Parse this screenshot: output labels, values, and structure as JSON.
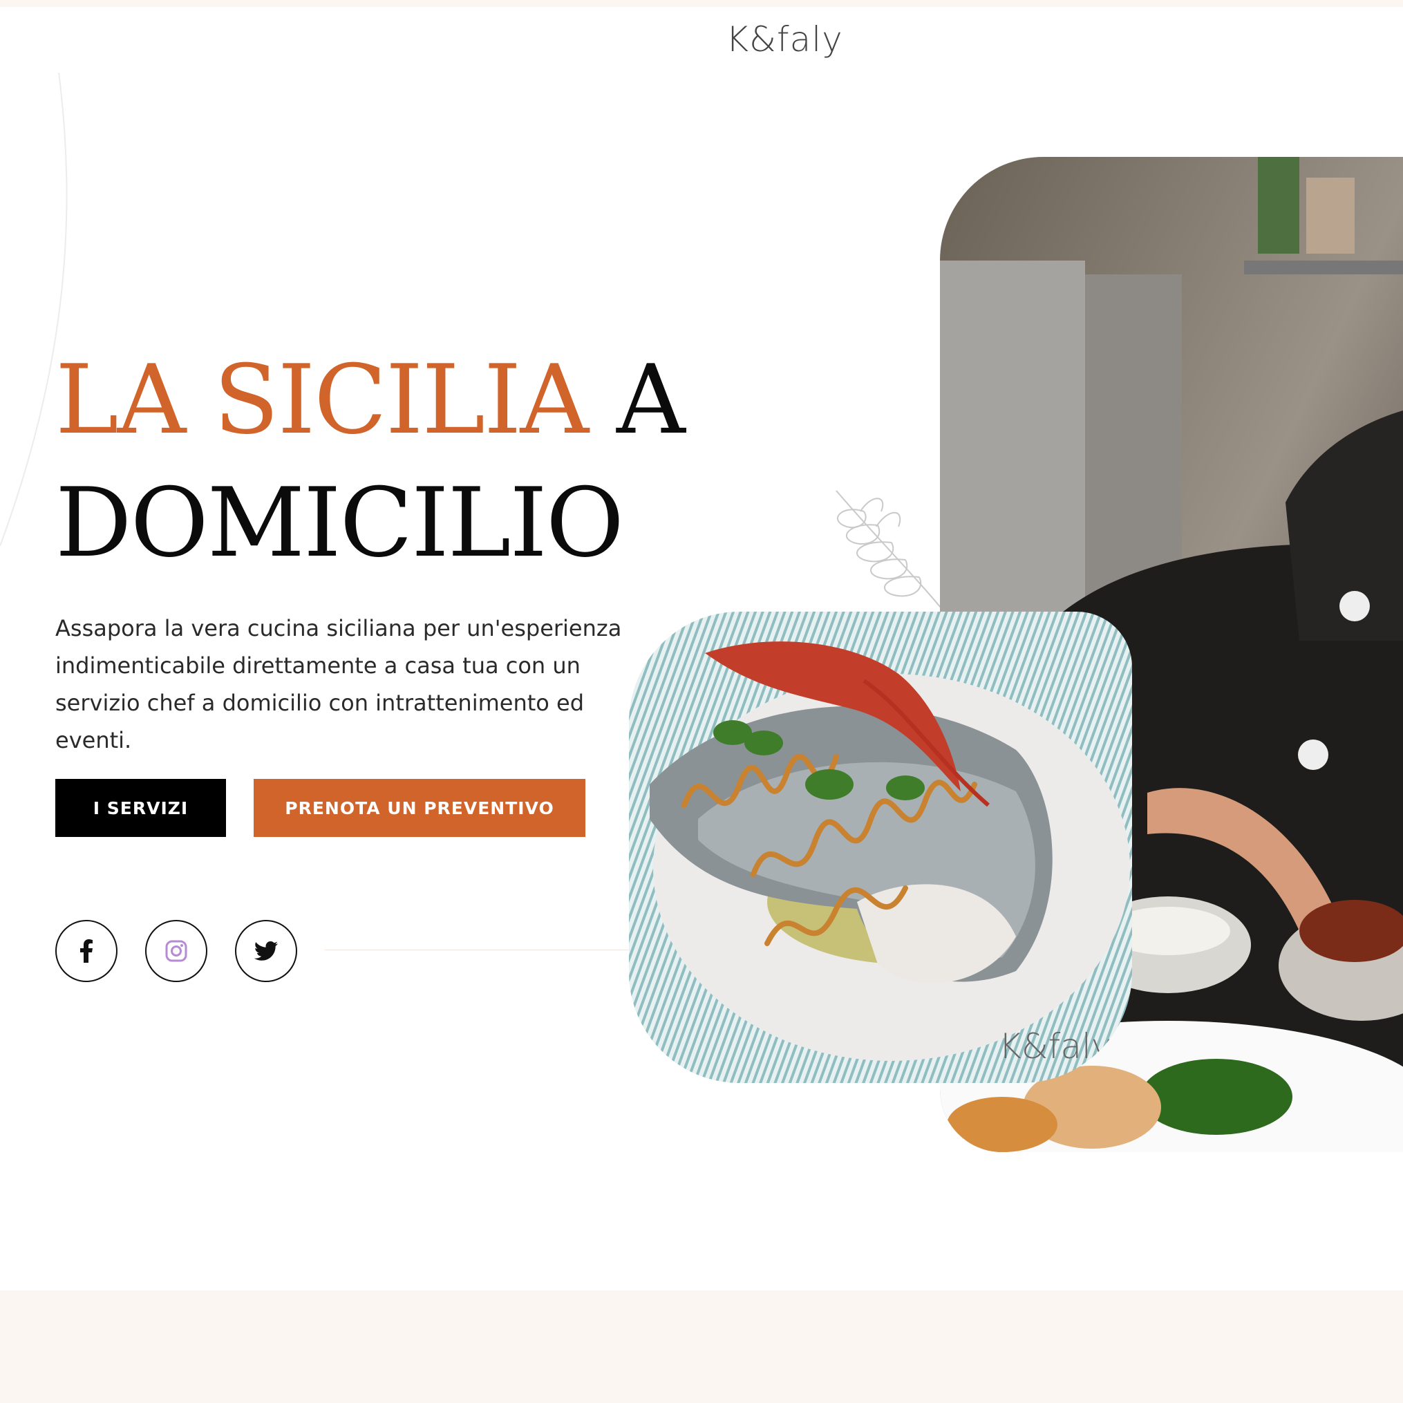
{
  "header": {
    "logo_text": "K&faly"
  },
  "hero": {
    "title_accent": "LA SICILIA",
    "title_rest": " A",
    "title_line2": "DOMICILIO",
    "description": "Assapora la vera cucina siciliana per un'esperienza indimenticabile direttamente a casa tua con un servizio chef a domicilio con intrattenimento ed eventi.",
    "buttons": {
      "services_label": "I SERVIZI",
      "quote_label": "PRENOTA UN PREVENTIVO"
    },
    "social": [
      {
        "icon": "facebook-icon"
      },
      {
        "icon": "instagram-icon"
      },
      {
        "icon": "twitter-icon"
      }
    ]
  },
  "images": {
    "photo": "chef plating dishes in kitchen",
    "plate": "sea bass fillet with shrimp and couscous",
    "plate_watermark": "K&faly"
  },
  "colors": {
    "accent": "#d0642b",
    "black": "#000000",
    "band": "#fcf6f3"
  }
}
